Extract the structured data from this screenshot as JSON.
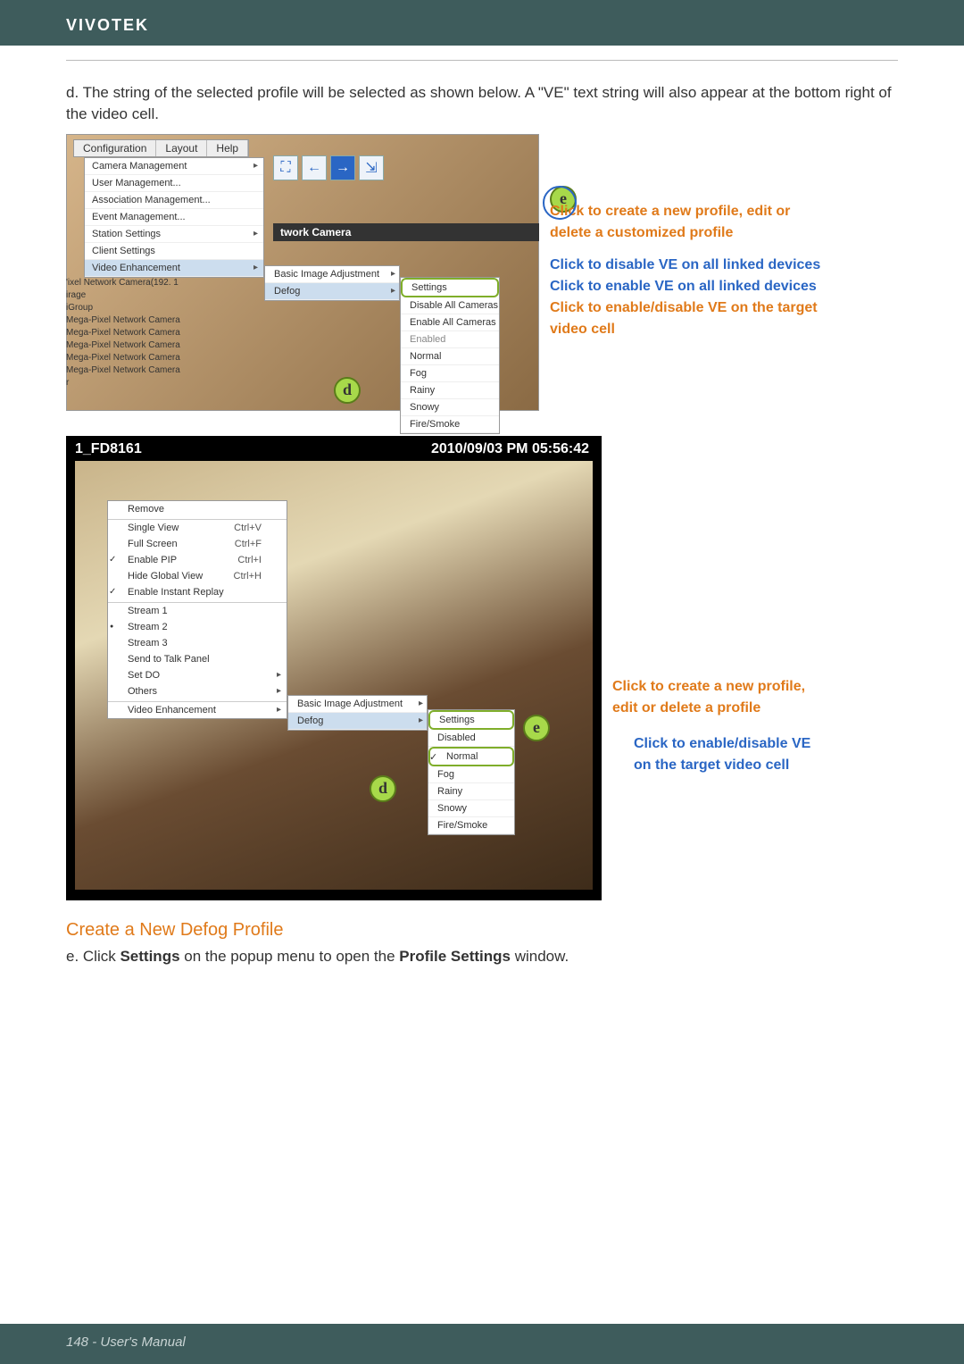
{
  "brand": "VIVOTEK",
  "intro": "d. The string of the selected profile will be selected as shown below. A \"VE\" text string will also appear at the bottom right of the video cell.",
  "fig1": {
    "menubar": [
      "Configuration",
      "Layout",
      "Help"
    ],
    "config_menu": [
      "Camera Management",
      "User Management...",
      "Association Management...",
      "Event Management...",
      "Station Settings",
      "Client Settings",
      "Video Enhancement"
    ],
    "ve_sub": [
      "Basic Image Adjustment",
      "Defog"
    ],
    "defog_sub": [
      "Settings",
      "Disable All Cameras",
      "Enable All Cameras",
      "Enabled",
      "Normal",
      "Fog",
      "Rainy",
      "Snowy",
      "Fire/Smoke"
    ],
    "title2": "twork Camera",
    "cam_list": [
      "'ixel Network Camera(192. 1",
      "irage",
      "iGroup",
      "Mega-Pixel Network Camera",
      "Mega-Pixel Network Camera",
      "Mega-Pixel Network Camera",
      "Mega-Pixel Network Camera",
      "Mega-Pixel Network Camera",
      "r"
    ],
    "badge_d": "d",
    "badge_e": "e"
  },
  "annotations1": {
    "l1a": "Click to create a new profile, edit or",
    "l1b": "delete a customized profile",
    "l2": "Click to disable VE on all linked devices",
    "l3": "Click to enable VE on all linked devices",
    "l4a": "Click to enable/disable VE on the target",
    "l4b": "video cell"
  },
  "fig2": {
    "title": "1_FD8161",
    "timestamp": "2010/09/03 PM 05:56:42",
    "ctx": [
      {
        "t": "Remove"
      },
      {
        "t": "Single View",
        "sc": "Ctrl+V",
        "sep": true
      },
      {
        "t": "Full Screen",
        "sc": "Ctrl+F"
      },
      {
        "t": "Enable PIP",
        "sc": "Ctrl+I",
        "chk": true
      },
      {
        "t": "Hide Global View",
        "sc": "Ctrl+H"
      },
      {
        "t": "Enable Instant Replay",
        "chk": true
      },
      {
        "t": "Stream 1",
        "sep": true
      },
      {
        "t": "Stream 2",
        "rad": true
      },
      {
        "t": "Stream 3"
      },
      {
        "t": "Send to Talk Panel"
      },
      {
        "t": "Set DO",
        "arr": true
      },
      {
        "t": "Others",
        "arr": true
      },
      {
        "t": "Video Enhancement",
        "arr": true,
        "sep": true
      }
    ],
    "ve_sub": [
      "Basic Image Adjustment",
      "Defog"
    ],
    "defog_sub": [
      "Settings",
      "Disabled",
      "Normal",
      "Fog",
      "Rainy",
      "Snowy",
      "Fire/Smoke"
    ],
    "defog_checked": "Normal",
    "badge_d": "d",
    "badge_e": "e"
  },
  "annotations2": {
    "l1a": "Click to create a new profile,",
    "l1b": "edit or delete a profile",
    "l2a": "Click to enable/disable VE",
    "l2b": "on the target video cell"
  },
  "section_title": "Create a New Defog Profile",
  "step_e_pre": "e. Click ",
  "step_e_bold1": "Settings",
  "step_e_mid": " on the popup menu to open the ",
  "step_e_bold2": "Profile Settings",
  "step_e_post": " window.",
  "footer": "148 - User's Manual"
}
